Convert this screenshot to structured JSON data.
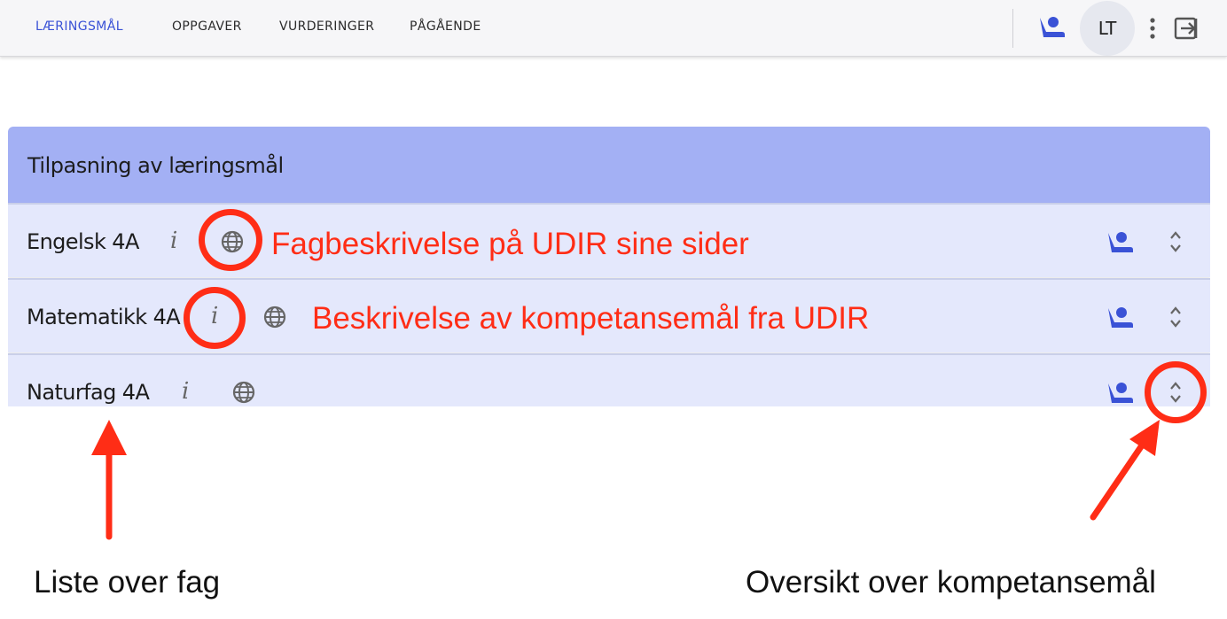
{
  "nav": {
    "tabs": [
      {
        "label": "LÆRINGSMÅL",
        "active": true
      },
      {
        "label": "OPPGAVER",
        "active": false
      },
      {
        "label": "VURDERINGER",
        "active": false
      },
      {
        "label": "PÅGÅENDE",
        "active": false
      }
    ],
    "user_initials": "LT",
    "icons": [
      "teacher-icon",
      "more-vert-icon",
      "logout-icon"
    ]
  },
  "panel": {
    "title": "Tilpasning av læringsmål",
    "subjects": [
      {
        "name": "Engelsk 4A",
        "info_glyph": "i"
      },
      {
        "name": "Matematikk 4A",
        "info_glyph": "i"
      },
      {
        "name": "Naturfag 4A",
        "info_glyph": "i"
      }
    ]
  },
  "annotations": {
    "globe_note": "Fagbeskrivelse på UDIR sine sider",
    "info_note": "Beskrivelse av kompetansemål fra UDIR",
    "list_note": "Liste over fag",
    "expand_note": "Oversikt over kompetansemål"
  },
  "colors": {
    "accent": "#3a52d6",
    "header_bg": "#a3b0f4",
    "row_bg": "#e4e8fc",
    "annotation_red": "#ff2d16"
  }
}
